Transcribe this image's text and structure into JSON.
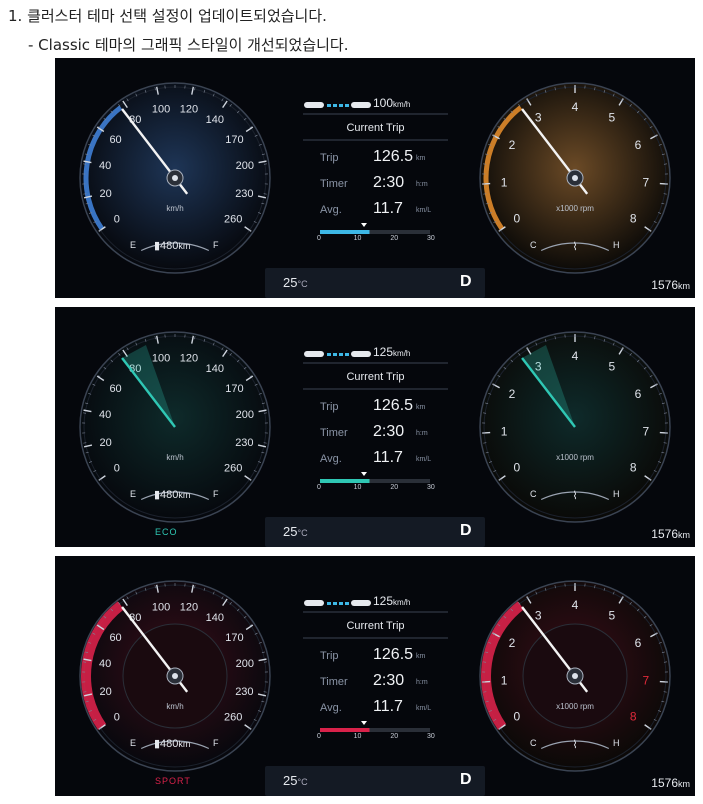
{
  "heading": "1. 클러스터 테마 선택 설정이 업데이트되었습니다.",
  "subheading": "- Classic 테마의 그래픽 스타일이 개선되었습니다.",
  "clusters": [
    {
      "theme": "classic",
      "mode_label": "",
      "accent": "#3f7fd6",
      "rpm_accent": "#e08a2a",
      "cruise_speed": "100",
      "cruise_unit": "km/h",
      "speedo_ticks": [
        "0",
        "20",
        "40",
        "60",
        "80",
        "100",
        "120",
        "140",
        "170",
        "200",
        "230",
        "260"
      ],
      "speed_unit": "km/h",
      "tacho_ticks": [
        "0",
        "1",
        "2",
        "3",
        "4",
        "5",
        "6",
        "7",
        "8"
      ],
      "tacho_unit": "x1000 rpm",
      "fuel_e": "E",
      "fuel_f": "F",
      "fuel_range": "480",
      "fuel_range_unit": "km",
      "temp_c": "C",
      "temp_h": "H",
      "trip_title": "Current Trip",
      "trip_label": "Trip",
      "trip_value": "126.5",
      "trip_unit": "km",
      "timer_label": "Timer",
      "timer_value": "2:30",
      "timer_unit": "h:m",
      "avg_label": "Avg.",
      "avg_value": "11.7",
      "avg_unit": "km/L",
      "eco_scale": [
        "0",
        "10",
        "20",
        "30"
      ],
      "eco_level": 0.45,
      "outside_temp": "25",
      "outside_temp_unit": "°C",
      "gear": "D",
      "odometer": "1576",
      "odometer_unit": "km",
      "speed_needle_value": 80,
      "rpm_needle_value": 3
    },
    {
      "theme": "eco",
      "mode_label": "ECO",
      "accent": "#2fc7b4",
      "rpm_accent": "#2fc7b4",
      "cruise_speed": "125",
      "cruise_unit": "km/h",
      "speedo_ticks": [
        "0",
        "20",
        "40",
        "60",
        "80",
        "100",
        "120",
        "140",
        "170",
        "200",
        "230",
        "260"
      ],
      "speed_unit": "km/h",
      "tacho_ticks": [
        "0",
        "1",
        "2",
        "3",
        "4",
        "5",
        "6",
        "7",
        "8"
      ],
      "tacho_unit": "x1000 rpm",
      "fuel_e": "E",
      "fuel_f": "F",
      "fuel_range": "480",
      "fuel_range_unit": "km",
      "temp_c": "C",
      "temp_h": "H",
      "trip_title": "Current Trip",
      "trip_label": "Trip",
      "trip_value": "126.5",
      "trip_unit": "km",
      "timer_label": "Timer",
      "timer_value": "2:30",
      "timer_unit": "h:m",
      "avg_label": "Avg.",
      "avg_value": "11.7",
      "avg_unit": "km/L",
      "eco_scale": [
        "0",
        "10",
        "20",
        "30"
      ],
      "eco_level": 0.45,
      "outside_temp": "25",
      "outside_temp_unit": "°C",
      "gear": "D",
      "odometer": "1576",
      "odometer_unit": "km",
      "speed_needle_value": 80,
      "rpm_needle_value": 3
    },
    {
      "theme": "sport",
      "mode_label": "SPORT",
      "accent": "#d9224a",
      "rpm_accent": "#d9224a",
      "cruise_speed": "125",
      "cruise_unit": "km/h",
      "speedo_ticks": [
        "0",
        "20",
        "40",
        "60",
        "80",
        "100",
        "120",
        "140",
        "170",
        "200",
        "230",
        "260"
      ],
      "speed_unit": "km/h",
      "tacho_ticks": [
        "0",
        "1",
        "2",
        "3",
        "4",
        "5",
        "6",
        "7",
        "8"
      ],
      "tacho_unit": "x1000 rpm",
      "fuel_e": "E",
      "fuel_f": "F",
      "fuel_range": "480",
      "fuel_range_unit": "km",
      "temp_c": "C",
      "temp_h": "H",
      "trip_title": "Current Trip",
      "trip_label": "Trip",
      "trip_value": "126.5",
      "trip_unit": "km",
      "timer_label": "Timer",
      "timer_value": "2:30",
      "timer_unit": "h:m",
      "avg_label": "Avg.",
      "avg_value": "11.7",
      "avg_unit": "km/L",
      "eco_scale": [
        "0",
        "10",
        "20",
        "30"
      ],
      "eco_level": 0.45,
      "outside_temp": "25",
      "outside_temp_unit": "°C",
      "gear": "D",
      "odometer": "1576",
      "odometer_unit": "km",
      "speed_needle_value": 80,
      "rpm_needle_value": 3
    }
  ]
}
